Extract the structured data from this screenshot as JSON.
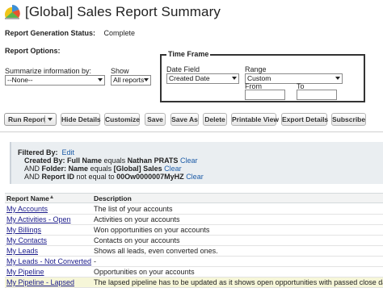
{
  "header": {
    "title": "[Global] Sales Report Summary",
    "icon": "report-icon",
    "status_label": "Report Generation Status:",
    "status_value": "Complete"
  },
  "options": {
    "label": "Report Options:",
    "summarize_label": "Summarize information by:",
    "summarize_value": "--None--",
    "show_label": "Show",
    "show_value": "All reports"
  },
  "timeframe": {
    "legend": "Time Frame",
    "date_field_label": "Date Field",
    "date_field_value": "Created Date",
    "range_label": "Range",
    "range_value": "Custom",
    "from_label": "From",
    "from_value": "",
    "to_label": "To",
    "to_value": ""
  },
  "toolbar": {
    "run_report": "Run Report",
    "hide_details": "Hide Details",
    "customize": "Customize",
    "save": "Save",
    "save_as": "Save As",
    "delete": "Delete",
    "printable_view": "Printable View",
    "export_details": "Export Details",
    "subscribe": "Subscribe"
  },
  "filters": {
    "filtered_by": "Filtered By:",
    "edit": "Edit",
    "line1_field": "Created By: Full Name",
    "line1_op": "equals",
    "line1_value": "Nathan PRATS",
    "line2_prefix": "AND",
    "line2_field": "Folder: Name",
    "line2_op": "equals",
    "line2_value": "[Global] Sales",
    "line3_prefix": "AND",
    "line3_field": "Report ID",
    "line3_op": "not equal to",
    "line3_value": "00Ow0000007MyHZ",
    "clear": "Clear"
  },
  "table": {
    "col_name": "Report Name",
    "col_desc": "Description",
    "rows": [
      {
        "name": "My Accounts",
        "desc": "The list of your accounts"
      },
      {
        "name": "My Activities - Open",
        "desc": "Activities on your accounts"
      },
      {
        "name": "My Billings",
        "desc": "Won opportunities on your accounts"
      },
      {
        "name": "My Contacts",
        "desc": "Contacts on your accounts"
      },
      {
        "name": "My Leads",
        "desc": "Shows all leads, even converted ones."
      },
      {
        "name": "My Leads - Not Converted",
        "desc": "-"
      },
      {
        "name": "My Pipeline",
        "desc": "Opportunities on your accounts"
      },
      {
        "name": "My Pipeline - Lapsed",
        "desc": "The lapsed pipeline has to be updated as it shows open opportunities with passed close dates"
      }
    ]
  }
}
